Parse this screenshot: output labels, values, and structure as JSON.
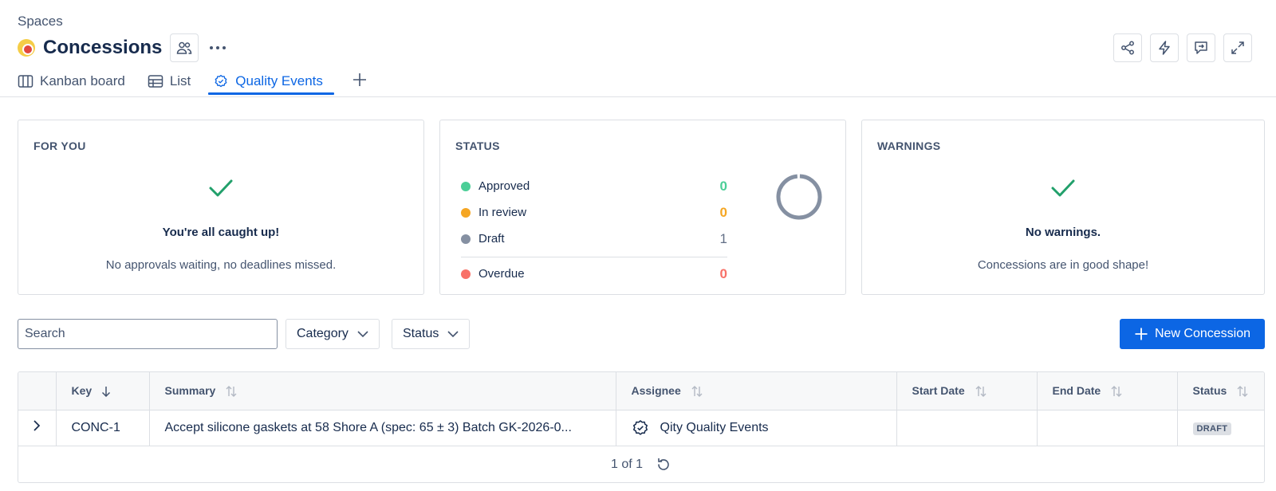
{
  "breadcrumb": "Spaces",
  "space": {
    "title": "Concessions",
    "logo_color": "#f5cd47",
    "logo_accent": "#e2483d"
  },
  "header_actions": [
    "share-icon",
    "automation-icon",
    "feedback-icon",
    "fullscreen-icon"
  ],
  "tabs": [
    {
      "label": "Kanban board",
      "icon": "kanban-icon"
    },
    {
      "label": "List",
      "icon": "list-icon"
    },
    {
      "label": "Quality Events",
      "icon": "verified-icon",
      "active": true
    }
  ],
  "cards": {
    "for_you": {
      "title": "FOR YOU",
      "heading": "You're all caught up!",
      "subtext": "No approvals waiting, no deadlines missed."
    },
    "status": {
      "title": "STATUS",
      "rows": [
        {
          "label": "Approved",
          "count": "0",
          "color": "#4bce97"
        },
        {
          "label": "In review",
          "count": "0",
          "color": "#f5a623"
        },
        {
          "label": "Draft",
          "count": "1",
          "color": "#8590a2"
        },
        {
          "label": "Overdue",
          "count": "0",
          "color": "#f87168"
        }
      ]
    },
    "warnings": {
      "title": "WARNINGS",
      "heading": "No warnings.",
      "subtext": "Concessions are in good shape!"
    }
  },
  "toolbar": {
    "search_placeholder": "Search",
    "category_label": "Category",
    "status_label": "Status",
    "new_button_label": "New Concession"
  },
  "table": {
    "columns": [
      "Key",
      "Summary",
      "Assignee",
      "Start Date",
      "End Date",
      "Status"
    ],
    "rows": [
      {
        "key": "CONC-1",
        "summary": "Accept silicone gaskets at 58 Shore A (spec: 65 ± 3) Batch GK-2026-0...",
        "assignee": "Qity Quality Events",
        "start_date": "",
        "end_date": "",
        "status": "DRAFT"
      }
    ],
    "pagination": "1 of 1"
  },
  "colors": {
    "brand": "#0c66e4",
    "success": "#22a06b",
    "text": "#172b4d",
    "subtle": "#44546f"
  }
}
